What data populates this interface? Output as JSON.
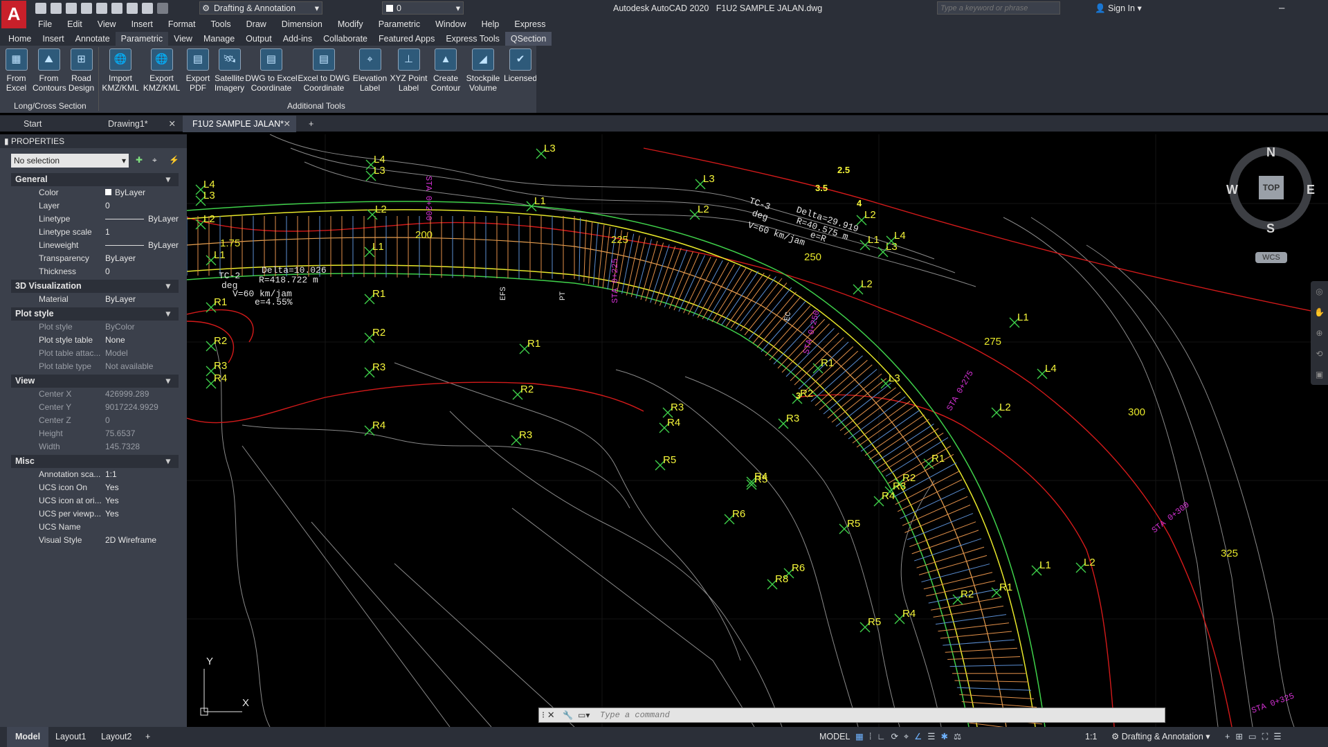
{
  "app": {
    "title": "Autodesk AutoCAD 2020",
    "file": "F1U2 SAMPLE JALAN.dwg",
    "workspace": "Drafting & Annotation",
    "layer": "0",
    "search_placeholder": "Type a keyword or phrase",
    "sign_in": "Sign In"
  },
  "menu": [
    "File",
    "Edit",
    "View",
    "Insert",
    "Format",
    "Tools",
    "Draw",
    "Dimension",
    "Modify",
    "Parametric",
    "Window",
    "Help",
    "Express"
  ],
  "ribbon_tabs": [
    "Home",
    "Insert",
    "Annotate",
    "Parametric",
    "View",
    "Manage",
    "Output",
    "Add-ins",
    "Collaborate",
    "Featured Apps",
    "Express Tools",
    "QSection"
  ],
  "ribbon_active": "QSection",
  "ribbon_panels": {
    "long_cross": {
      "label": "Long/Cross Section",
      "buttons": [
        [
          "From",
          "Excel"
        ],
        [
          "From",
          "Contours"
        ],
        [
          "Road",
          "Design"
        ]
      ]
    },
    "additional": {
      "label": "Additional Tools",
      "buttons": [
        [
          "Import",
          "KMZ/KML"
        ],
        [
          "Export",
          "KMZ/KML"
        ],
        [
          "Export",
          "PDF"
        ],
        [
          "Satellite",
          "Imagery"
        ],
        [
          "DWG to Excel",
          "Coordinate"
        ],
        [
          "Excel to DWG",
          "Coordinate"
        ],
        [
          "Elevation",
          "Label"
        ],
        [
          "XYZ Point",
          "Label"
        ],
        [
          "Create",
          "Contour"
        ],
        [
          "Stockpile",
          "Volume"
        ],
        [
          "Licensed",
          ""
        ]
      ]
    }
  },
  "doc_tabs": [
    "Start",
    "Drawing1*",
    "F1U2 SAMPLE JALAN*"
  ],
  "properties": {
    "title": "PROPERTIES",
    "selection": "No selection",
    "sections": [
      {
        "name": "General",
        "rows": [
          [
            "Color",
            "ByLayer"
          ],
          [
            "Layer",
            "0"
          ],
          [
            "Linetype",
            "ByLayer"
          ],
          [
            "Linetype scale",
            "1"
          ],
          [
            "Lineweight",
            "ByLayer"
          ],
          [
            "Transparency",
            "ByLayer"
          ],
          [
            "Thickness",
            "0"
          ]
        ]
      },
      {
        "name": "3D Visualization",
        "rows": [
          [
            "Material",
            "ByLayer"
          ]
        ]
      },
      {
        "name": "Plot style",
        "rows": [
          [
            "Plot style",
            "ByColor"
          ],
          [
            "Plot style table",
            "None"
          ],
          [
            "Plot table attac...",
            "Model"
          ],
          [
            "Plot table type",
            "Not available"
          ]
        ]
      },
      {
        "name": "View",
        "rows": [
          [
            "Center X",
            "426999.289"
          ],
          [
            "Center Y",
            "9017224.9929"
          ],
          [
            "Center Z",
            "0"
          ],
          [
            "Height",
            "75.6537"
          ],
          [
            "Width",
            "145.7328"
          ]
        ]
      },
      {
        "name": "Misc",
        "rows": [
          [
            "Annotation sca...",
            "1:1"
          ],
          [
            "UCS icon On",
            "Yes"
          ],
          [
            "UCS icon at ori...",
            "Yes"
          ],
          [
            "UCS per viewp...",
            "Yes"
          ],
          [
            "UCS Name",
            ""
          ],
          [
            "Visual Style",
            "2D Wireframe"
          ]
        ]
      }
    ]
  },
  "viewcube": {
    "n": "N",
    "s": "S",
    "e": "E",
    "w": "W",
    "top": "TOP",
    "wcs": "WCS"
  },
  "ucs": {
    "x": "X",
    "y": "Y"
  },
  "command_placeholder": "Type a command",
  "layout_tabs": [
    "Model",
    "Layout1",
    "Layout2"
  ],
  "status": {
    "model": "MODEL",
    "scale": "1:1",
    "workspace": "Drafting & Annotation"
  },
  "drawing_labels": {
    "curve1": [
      "TC-2",
      "Delta=10.026",
      "deg",
      "R=418.722 m",
      "V=60 km/jam",
      "e=4.55%"
    ],
    "curve2": [
      "TC-3",
      "Delta=29.919",
      "deg",
      "R=40.575 m",
      "V=60 km/jam",
      "e=R"
    ],
    "stations": [
      "200",
      "225",
      "250",
      "275",
      "300",
      "325"
    ],
    "sta": [
      "STA 0+200",
      "STA 0+225",
      "STA 0+250",
      "STA 0+275",
      "STA 0+300",
      "STA 0+325"
    ],
    "points_l": [
      "L1",
      "L2",
      "L3",
      "L4"
    ],
    "points_r": [
      "R1",
      "R2",
      "R3",
      "R4",
      "R5",
      "R6",
      "R8"
    ],
    "misc": [
      "EFS",
      "PT",
      "EC",
      "2.5",
      "3.5",
      "4",
      "3",
      "1.75"
    ]
  }
}
